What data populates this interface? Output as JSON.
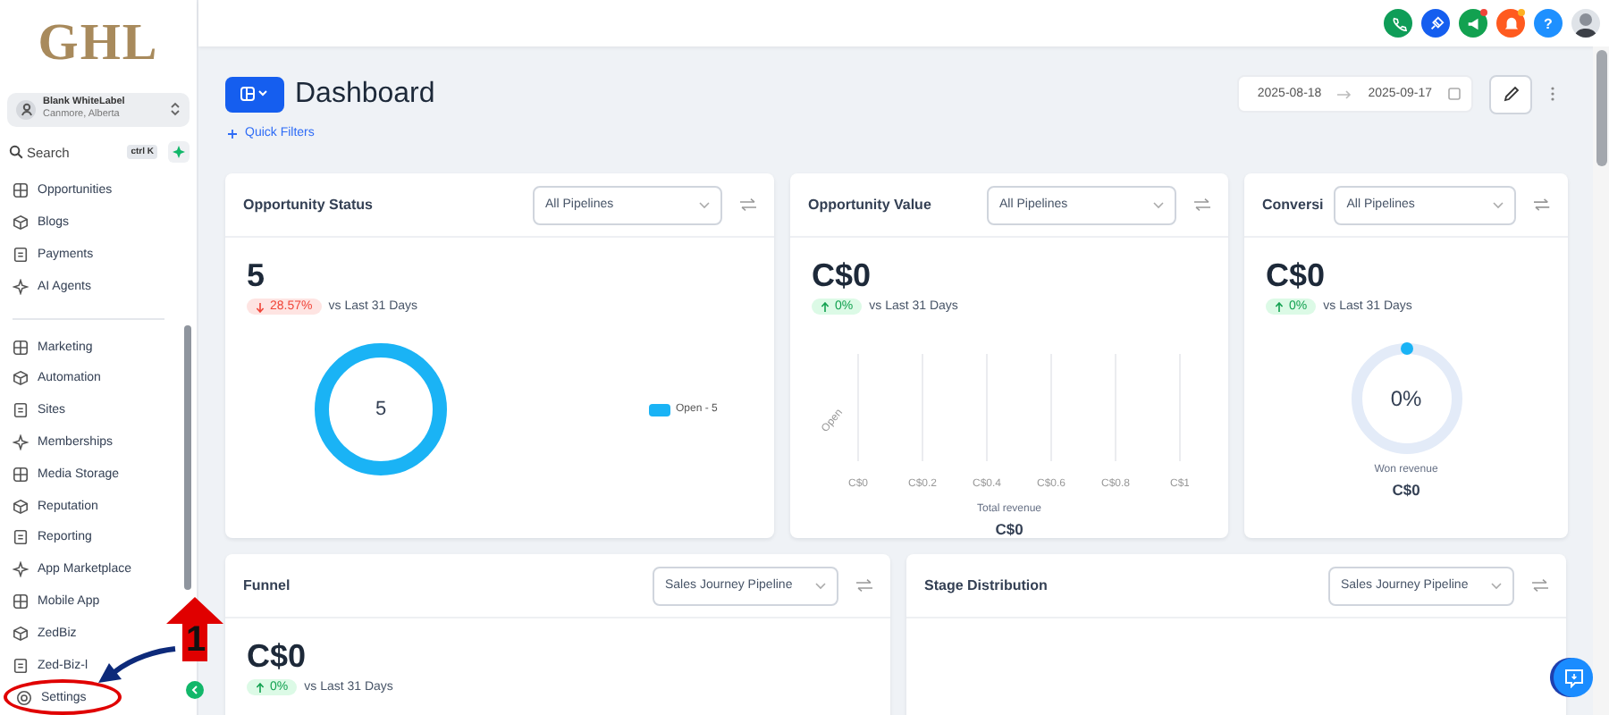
{
  "logo": "GHL",
  "account": {
    "name": "Blank WhiteLabel",
    "location": "Canmore, Alberta"
  },
  "search": {
    "placeholder": "Search",
    "shortcut": "ctrl K"
  },
  "sidebar": {
    "groups": [
      {
        "items": [
          {
            "label": "Opportunities"
          },
          {
            "label": "Blogs"
          },
          {
            "label": "Payments"
          },
          {
            "label": "AI Agents"
          }
        ]
      },
      {
        "items": [
          {
            "label": "Marketing"
          },
          {
            "label": "Automation"
          },
          {
            "label": "Sites"
          },
          {
            "label": "Memberships"
          },
          {
            "label": "Media Storage"
          },
          {
            "label": "Reputation"
          },
          {
            "label": "Reporting"
          },
          {
            "label": "App Marketplace"
          },
          {
            "label": "Mobile App"
          },
          {
            "label": "ZedBiz"
          },
          {
            "label": "Zed-Biz-l"
          }
        ]
      },
      {
        "items": [
          {
            "label": "Settings"
          }
        ]
      }
    ]
  },
  "top_actions": [
    {
      "unread": false
    },
    {
      "unread": false
    },
    {
      "unread": true
    },
    {
      "unread": true
    },
    {
      "label": "?",
      "unread": false
    }
  ],
  "header": {
    "title": "Dashboard",
    "quick_filters": "Quick Filters",
    "date_start": "2025-08-18",
    "date_end": "2025-09-17"
  },
  "cards": {
    "opportunity_status": {
      "title": "Opportunity Status",
      "filter": "All Pipelines",
      "value": "5",
      "change": {
        "text": "28.57%",
        "rising": false
      },
      "compare": "vs Last 31 Days",
      "center": "5",
      "legend": "Open - 5"
    },
    "opportunity_value": {
      "title": "Opportunity Value",
      "filter": "All Pipelines",
      "value": "C$0",
      "change": {
        "text": "0%",
        "rising": true
      },
      "compare": "vs Last 31 Days",
      "category": "Open",
      "axis_labels": [
        "C$0",
        "C$0.2",
        "C$0.4",
        "C$0.6",
        "C$0.8",
        "C$1"
      ],
      "summary_label": "Total revenue",
      "summary_value": "C$0"
    },
    "conversion": {
      "title": "Conversi",
      "filter": "All Pipelines",
      "value": "C$0",
      "change": {
        "text": "0%",
        "rising": true
      },
      "compare": "vs Last 31 Days",
      "center": "0%",
      "summary_label": "Won revenue",
      "summary_value": "C$0"
    },
    "funnel": {
      "title": "Funnel",
      "filter": "Sales Journey Pipeline",
      "value": "C$0",
      "change": {
        "text": "0%",
        "rising": true
      },
      "compare": "vs Last 31 Days"
    },
    "stage_distribution": {
      "title": "Stage Distribution",
      "filter": "Sales Journey Pipeline"
    }
  },
  "annotation": {
    "step": "1"
  }
}
